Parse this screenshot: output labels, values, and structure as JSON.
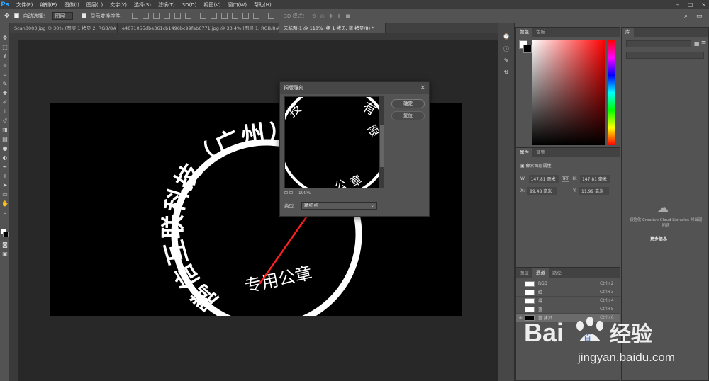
{
  "app": {
    "logo": "Ps"
  },
  "menubar": {
    "items": [
      "文件(F)",
      "编辑(E)",
      "图像(I)",
      "图层(L)",
      "文字(Y)",
      "选择(S)",
      "滤镜(T)",
      "3D(D)",
      "视图(V)",
      "窗口(W)",
      "帮助(H)"
    ],
    "window_buttons": [
      "–",
      "□",
      "×"
    ]
  },
  "options": {
    "auto_select_label": "自动选择：",
    "auto_select_target": "图层",
    "show_transform_label": "显示变换控件",
    "mode_3d_label": "3D 模式："
  },
  "tabs": [
    {
      "label": "Scan0003.jpg @ 30% (图层 1 拷贝 2, RGB/8#) *",
      "active": false
    },
    {
      "label": "e4871055dbe361cb1496bc99fab6771.jpg @ 33.4% (图层 1, RGB/8#) *",
      "active": false
    },
    {
      "label": "未标题-1 @ 118% (组 1 拷贝, 蓝 拷贝/8) *",
      "active": true
    }
  ],
  "stamp": {
    "arc_text": "腾信互联科技（广州）有限公司",
    "bottom_text": "专用公章"
  },
  "dialog": {
    "title": "铜版雕刻",
    "close": "×",
    "ok_label": "确定",
    "reset_label": "复位",
    "zoom_minus": "⊟",
    "zoom_plus": "⊞",
    "zoom_value": "100%",
    "type_label": "类型",
    "type_value": "精细点",
    "preview_chars": [
      "技",
      "有",
      "限",
      "公",
      "章"
    ]
  },
  "panels": {
    "color": {
      "tabs": [
        "颜色",
        "色板"
      ]
    },
    "properties": {
      "tabs": [
        "属性",
        "调整"
      ],
      "section": "像素图层属性",
      "w_label": "W:",
      "w_value": "147.81 毫米",
      "h_label": "H:",
      "h_value": "147.81 毫米",
      "x_label": "X:",
      "x_value": "99.48 毫米",
      "y_label": "Y:",
      "y_value": "11.99 毫米",
      "link_label": "GO"
    },
    "channels": {
      "tabs": [
        "图层",
        "通道",
        "路径"
      ],
      "rows": [
        {
          "name": "RGB",
          "shortcut": "Ctrl+2"
        },
        {
          "name": "红",
          "shortcut": "Ctrl+3"
        },
        {
          "name": "绿",
          "shortcut": "Ctrl+4"
        },
        {
          "name": "蓝",
          "shortcut": "Ctrl+5"
        },
        {
          "name": "蓝 拷贝",
          "shortcut": "Ctrl+6"
        }
      ]
    },
    "library": {
      "title": "库",
      "message": "初始化 Creative Cloud Libraries 时出现问题",
      "link": "更多信息"
    }
  },
  "watermark": {
    "brand": "Bai",
    "brand2": "百",
    "brand3": "经验",
    "url": "jingyan.baidu.com"
  },
  "colors": {
    "accent": "#31a8ff",
    "arrow": "#ff2020",
    "baidu_blue": "#2e64d1"
  }
}
